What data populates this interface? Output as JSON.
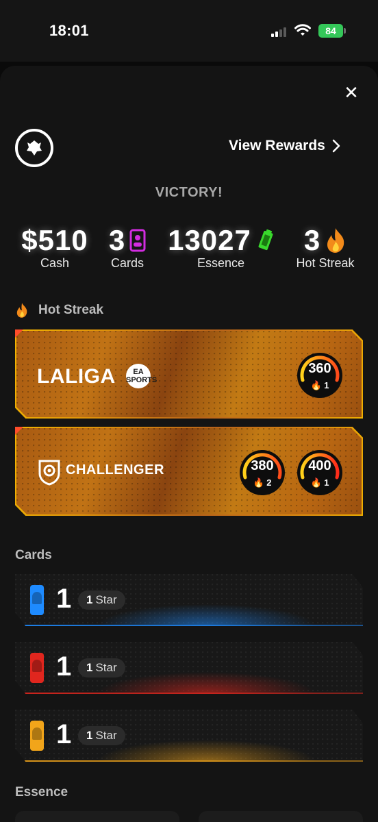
{
  "status_bar": {
    "time": "18:01",
    "battery": "84"
  },
  "header": {
    "view_rewards_label": "View Rewards"
  },
  "result": {
    "title": "VICTORY!"
  },
  "stats": {
    "cash": {
      "value": "$510",
      "label": "Cash"
    },
    "cards": {
      "value": "3",
      "label": "Cards"
    },
    "essence": {
      "value": "13027",
      "label": "Essence"
    },
    "hot_streak": {
      "value": "3",
      "label": "Hot Streak"
    }
  },
  "hot_streak_section": {
    "title": "Hot Streak",
    "leagues": [
      {
        "name": "LALIGA",
        "badge": "EA SPORTS",
        "gauges": [
          {
            "value": "360",
            "count": "1"
          }
        ]
      },
      {
        "name": "CHALLENGER",
        "gauges": [
          {
            "value": "380",
            "count": "2"
          },
          {
            "value": "400",
            "count": "1"
          }
        ]
      }
    ]
  },
  "cards_section": {
    "title": "Cards",
    "rows": [
      {
        "count": "1",
        "star_num": "1",
        "star_label": "Star",
        "color": "#1e8bff"
      },
      {
        "count": "1",
        "star_num": "1",
        "star_label": "Star",
        "color": "#e0261e"
      },
      {
        "count": "1",
        "star_num": "1",
        "star_label": "Star",
        "color": "#f2a51a"
      }
    ]
  },
  "essence_section": {
    "title": "Essence"
  },
  "colors": {
    "accent_orange": "#f29c1a",
    "cards_icon": "#d22ce0",
    "essence_icon": "#39d82c",
    "battery": "#34c759"
  }
}
